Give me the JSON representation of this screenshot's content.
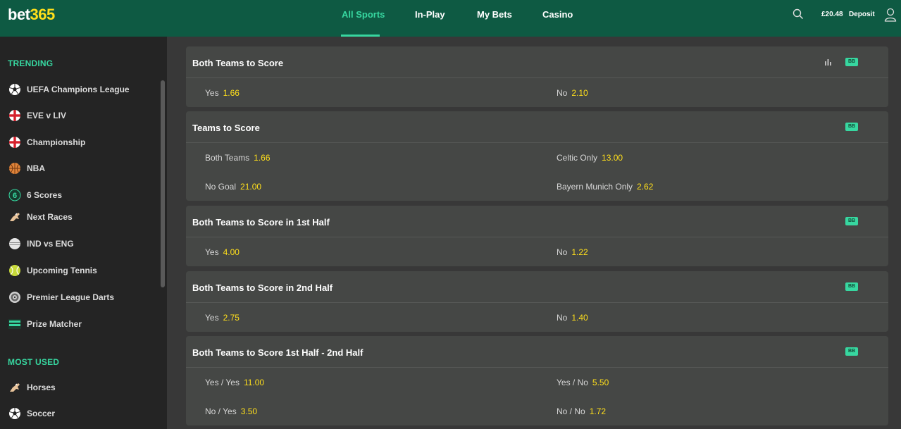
{
  "header": {
    "logo_main": "bet",
    "logo_num": "365",
    "nav": [
      {
        "label": "All Sports"
      },
      {
        "label": "In-Play"
      },
      {
        "label": "My Bets"
      },
      {
        "label": "Casino"
      }
    ],
    "balance": "£20.48",
    "deposit_label": "Deposit",
    "accent_color": "#37d7a0"
  },
  "sidebar": {
    "trending_heading": "TRENDING",
    "trending": [
      {
        "label": "UEFA Champions League",
        "icon": "soccer-ball-icon"
      },
      {
        "label": "EVE v LIV",
        "icon": "england-flag-icon"
      },
      {
        "label": "Championship",
        "icon": "england-flag-icon"
      },
      {
        "label": "NBA",
        "icon": "basketball-icon"
      },
      {
        "label": "6 Scores",
        "icon": "six-scores-icon"
      },
      {
        "label": "Next Races",
        "icon": "horse-icon"
      },
      {
        "label": "IND vs ENG",
        "icon": "cricket-ball-icon"
      },
      {
        "label": "Upcoming Tennis",
        "icon": "tennis-ball-icon"
      },
      {
        "label": "Premier League Darts",
        "icon": "dartboard-icon"
      },
      {
        "label": "Prize Matcher",
        "icon": "prize-matcher-icon"
      }
    ],
    "most_used_heading": "MOST USED",
    "most_used": [
      {
        "label": "Horses",
        "icon": "horse-icon"
      },
      {
        "label": "Soccer",
        "icon": "soccer-ball-icon"
      }
    ]
  },
  "markets": [
    {
      "title": "Both Teams to Score",
      "badge": "BB",
      "rows": [
        [
          {
            "name": "Yes",
            "odds": "1.66"
          },
          {
            "name": "No",
            "odds": "2.10"
          }
        ]
      ]
    },
    {
      "title": "Teams to Score",
      "badge": "BB",
      "rows": [
        [
          {
            "name": "Both Teams",
            "odds": "1.66"
          },
          {
            "name": "Celtic Only",
            "odds": "13.00"
          }
        ],
        [
          {
            "name": "No Goal",
            "odds": "21.00"
          },
          {
            "name": "Bayern Munich Only",
            "odds": "2.62"
          }
        ]
      ]
    },
    {
      "title": "Both Teams to Score in 1st Half",
      "badge": "BB",
      "rows": [
        [
          {
            "name": "Yes",
            "odds": "4.00"
          },
          {
            "name": "No",
            "odds": "1.22"
          }
        ]
      ]
    },
    {
      "title": "Both Teams to Score in 2nd Half",
      "badge": "BB",
      "rows": [
        [
          {
            "name": "Yes",
            "odds": "2.75"
          },
          {
            "name": "No",
            "odds": "1.40"
          }
        ]
      ]
    },
    {
      "title": "Both Teams to Score 1st Half - 2nd Half",
      "badge": "BB",
      "rows": [
        [
          {
            "name": "Yes / Yes",
            "odds": "11.00"
          },
          {
            "name": "Yes / No",
            "odds": "5.50"
          }
        ],
        [
          {
            "name": "No / Yes",
            "odds": "3.50"
          },
          {
            "name": "No / No",
            "odds": "1.72"
          }
        ]
      ]
    }
  ]
}
